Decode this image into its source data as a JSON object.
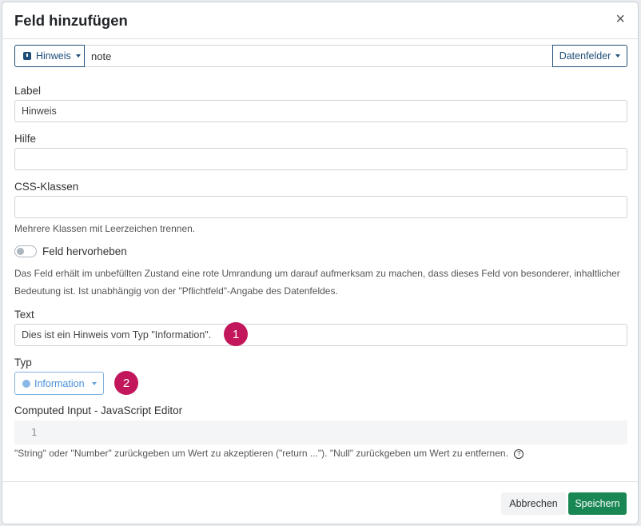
{
  "dialog": {
    "title": "Feld hinzufügen",
    "close_icon": "×"
  },
  "top_row": {
    "type_button_label": "Hinweis",
    "field_name_value": "note",
    "datenfelder_label": "Datenfelder"
  },
  "label_field": {
    "label": "Label",
    "value": "Hinweis"
  },
  "hilfe_field": {
    "label": "Hilfe",
    "value": ""
  },
  "css_field": {
    "label": "CSS-Klassen",
    "value": "",
    "help": "Mehrere Klassen mit Leerzeichen trennen."
  },
  "highlight_toggle": {
    "label": "Feld hervorheben",
    "checked": false,
    "description": "Das Feld erhält im unbefüllten Zustand eine rote Umrandung um darauf aufmerksam zu machen, dass dieses Feld von besonderer, inhaltlicher Bedeutung ist. Ist unabhängig von der \"Pflichtfeld\"-Angabe des Datenfeldes."
  },
  "text_field": {
    "label": "Text",
    "value": "Dies ist ein Hinweis vom Typ \"Information\".",
    "badge": "1"
  },
  "typ_field": {
    "label": "Typ",
    "value": "Information",
    "badge": "2"
  },
  "computed_input": {
    "label": "Computed Input - JavaScript Editor",
    "line_number": "1",
    "help": "\"String\" oder \"Number\" zurückgeben um Wert zu akzeptieren (\"return ...\"). \"Null\" zurückgeben um Wert zu entfernen.",
    "help_icon": "?"
  },
  "footer": {
    "cancel_label": "Abbrechen",
    "save_label": "Speichern"
  },
  "colors": {
    "primary": "#1f4e79",
    "badge": "#c2185b",
    "info": "#4a90d9",
    "save": "#198754"
  }
}
